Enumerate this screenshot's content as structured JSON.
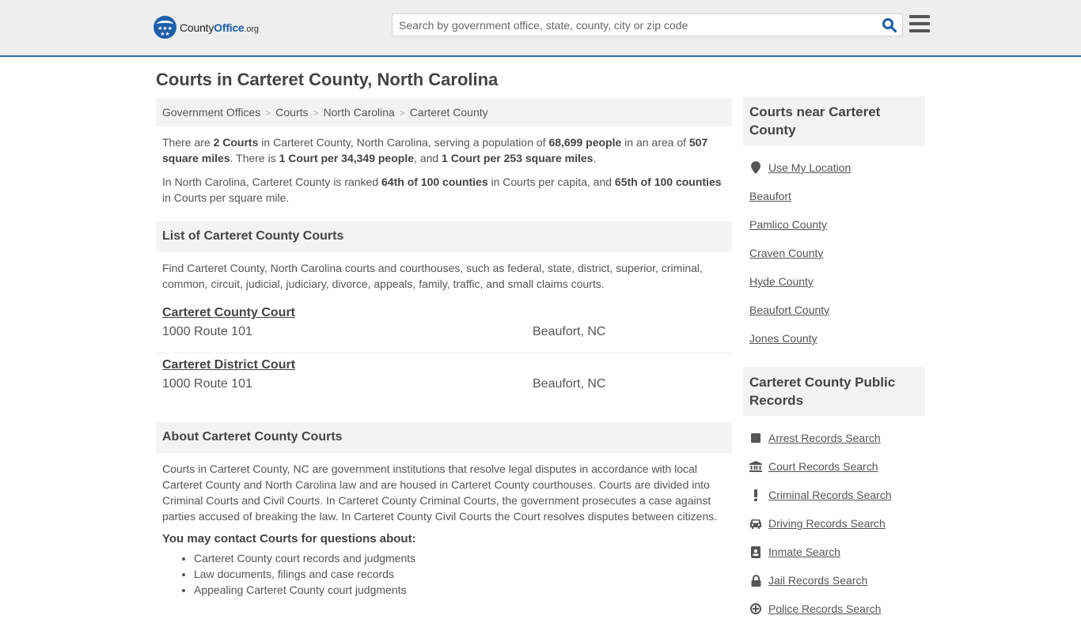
{
  "header": {
    "logo_primary": "County",
    "logo_accent": "Office",
    "logo_suffix": ".org",
    "search_placeholder": "Search by government office, state, county, city or zip code",
    "search_value": ""
  },
  "page_title": "Courts in Carteret County, North Carolina",
  "breadcrumb": [
    {
      "label": "Government Offices"
    },
    {
      "label": "Courts"
    },
    {
      "label": "North Carolina"
    },
    {
      "label": "Carteret County"
    }
  ],
  "intro": {
    "p1": {
      "t1": "There are ",
      "b1": "2 Courts",
      "t2": " in Carteret County, North Carolina, serving a population of ",
      "b2": "68,699 people",
      "t3": " in an area of ",
      "b3": "507 square miles",
      "t4": ". There is ",
      "b4": "1 Court per 34,349 people",
      "t5": ", and ",
      "b5": "1 Court per 253 square miles",
      "t6": "."
    },
    "p2": {
      "t1": "In North Carolina, Carteret County is ranked ",
      "b1": "64th of 100 counties",
      "t2": " in Courts per capita, and ",
      "b2": "65th of 100 counties",
      "t3": " in Courts per square mile."
    }
  },
  "list_section": {
    "heading": "List of Carteret County Courts",
    "description": "Find Carteret County, North Carolina courts and courthouses, such as federal, state, district, superior, criminal, common, circuit, judicial, judiciary, divorce, appeals, family, traffic, and small claims courts.",
    "courts": [
      {
        "name": "Carteret County Court",
        "address": "1000 Route 101",
        "city": "Beaufort, NC"
      },
      {
        "name": "Carteret District Court",
        "address": "1000 Route 101",
        "city": "Beaufort, NC"
      }
    ]
  },
  "about_section": {
    "heading": "About Carteret County Courts",
    "body": "Courts in Carteret County, NC are government institutions that resolve legal disputes in accordance with local Carteret County and North Carolina law and are housed in Carteret County courthouses. Courts are divided into Criminal Courts and Civil Courts. In Carteret County Criminal Courts, the government prosecutes a case against parties accused of breaking the law. In Carteret County Civil Courts the Court resolves disputes between citizens.",
    "contact_heading": "You may contact Courts for questions about:",
    "contact_items": [
      "Carteret County court records and judgments",
      "Law documents, filings and case records",
      "Appealing Carteret County court judgments"
    ]
  },
  "sidebar": {
    "nearby": {
      "heading": "Courts near Carteret County",
      "use_location": "Use My Location",
      "items": [
        "Beaufort",
        "Pamlico County",
        "Craven County",
        "Hyde County",
        "Beaufort County",
        "Jones County"
      ]
    },
    "records": {
      "heading": "Carteret County Public Records",
      "items": [
        {
          "label": "Arrest Records Search",
          "icon": "square-icon"
        },
        {
          "label": "Court Records Search",
          "icon": "courthouse-icon"
        },
        {
          "label": "Criminal Records Search",
          "icon": "exclamation-icon"
        },
        {
          "label": "Driving Records Search",
          "icon": "car-icon"
        },
        {
          "label": "Inmate Search",
          "icon": "id-badge-icon"
        },
        {
          "label": "Jail Records Search",
          "icon": "lock-icon"
        },
        {
          "label": "Police Records Search",
          "icon": "shield-icon"
        }
      ]
    }
  },
  "colors": {
    "brand_blue": "#1d5ea8",
    "header_border": "#2f6fb1",
    "header_bg": "#eeeeee",
    "section_bg": "#f3f3f3",
    "text": "#555555"
  }
}
